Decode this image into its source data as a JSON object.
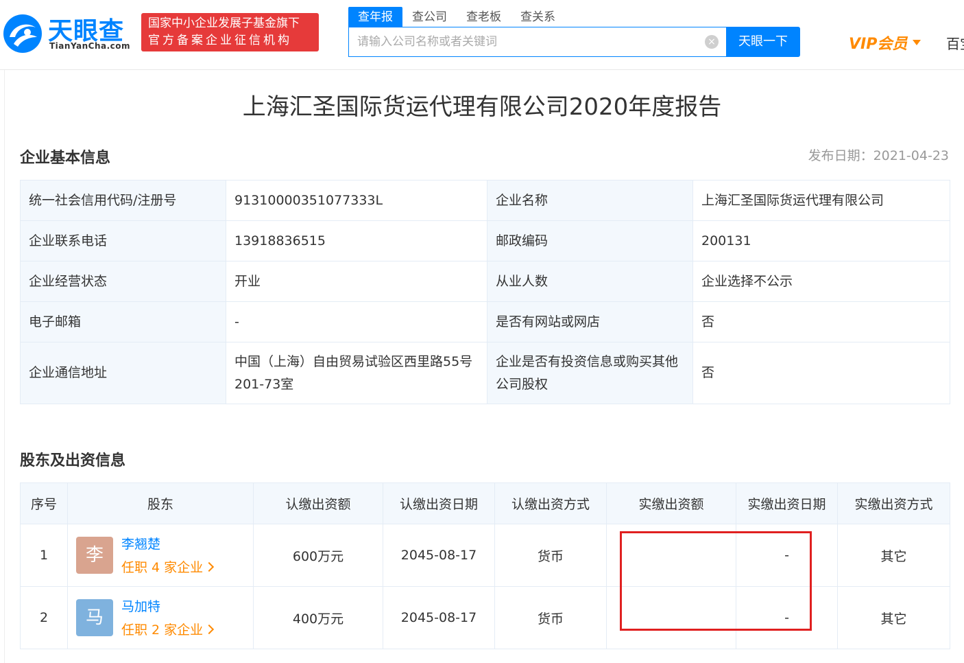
{
  "header": {
    "logo_text": "天眼查",
    "logo_pinyin": "TianYanCha.com",
    "badge_line1": "国家中小企业发展子基金旗下",
    "badge_line2": "官方备案企业征信机构",
    "tabs": [
      {
        "label": "查年报",
        "active": true
      },
      {
        "label": "查公司",
        "active": false
      },
      {
        "label": "查老板",
        "active": false
      },
      {
        "label": "查关系",
        "active": false
      }
    ],
    "search_placeholder": "请输入公司名称或者关键词",
    "search_button": "天眼一下",
    "vip_label": "VIP会员",
    "baike_label": "百宝",
    "accent_color": "#0084ff",
    "vip_color": "#ff8a00"
  },
  "page_title": "上海汇圣国际货运代理有限公司2020年度报告",
  "basic_info": {
    "title": "企业基本信息",
    "publish_date": "发布日期：2021-04-23",
    "rows": [
      {
        "label1": "统一社会信用代码/注册号",
        "value1": "91310000351077333L",
        "label2": "企业名称",
        "value2": "上海汇圣国际货运代理有限公司"
      },
      {
        "label1": "企业联系电话",
        "value1": "13918836515",
        "label2": "邮政编码",
        "value2": "200131"
      },
      {
        "label1": "企业经营状态",
        "value1": "开业",
        "label2": "从业人数",
        "value2": "企业选择不公示"
      },
      {
        "label1": "电子邮箱",
        "value1": "-",
        "label2": "是否有网站或网店",
        "value2": "否"
      },
      {
        "label1": "企业通信地址",
        "value1": "中国（上海）自由贸易试验区西里路55号201-73室",
        "label2": "企业是否有投资信息或购买其他公司股权",
        "value2": "否"
      }
    ]
  },
  "shareholders": {
    "title": "股东及出资信息",
    "columns": [
      "序号",
      "股东",
      "认缴出资额",
      "认缴出资日期",
      "认缴出资方式",
      "实缴出资额",
      "实缴出资日期",
      "实缴出资方式"
    ],
    "rows": [
      {
        "index": "1",
        "avatar": "李",
        "avatar_color": "#d9a48f",
        "name": "李翘楚",
        "link": "任职 4 家企业",
        "subscribed_amount": "600万元",
        "subscribed_date": "2045-08-17",
        "subscribed_method": "货币",
        "paid_amount": "",
        "paid_date": "-",
        "paid_method": "其它"
      },
      {
        "index": "2",
        "avatar": "马",
        "avatar_color": "#7fb2de",
        "name": "马加特",
        "link": "任职 2 家企业",
        "subscribed_amount": "400万元",
        "subscribed_date": "2045-08-17",
        "subscribed_method": "货币",
        "paid_amount": "",
        "paid_date": "-",
        "paid_method": "其它"
      }
    ]
  }
}
